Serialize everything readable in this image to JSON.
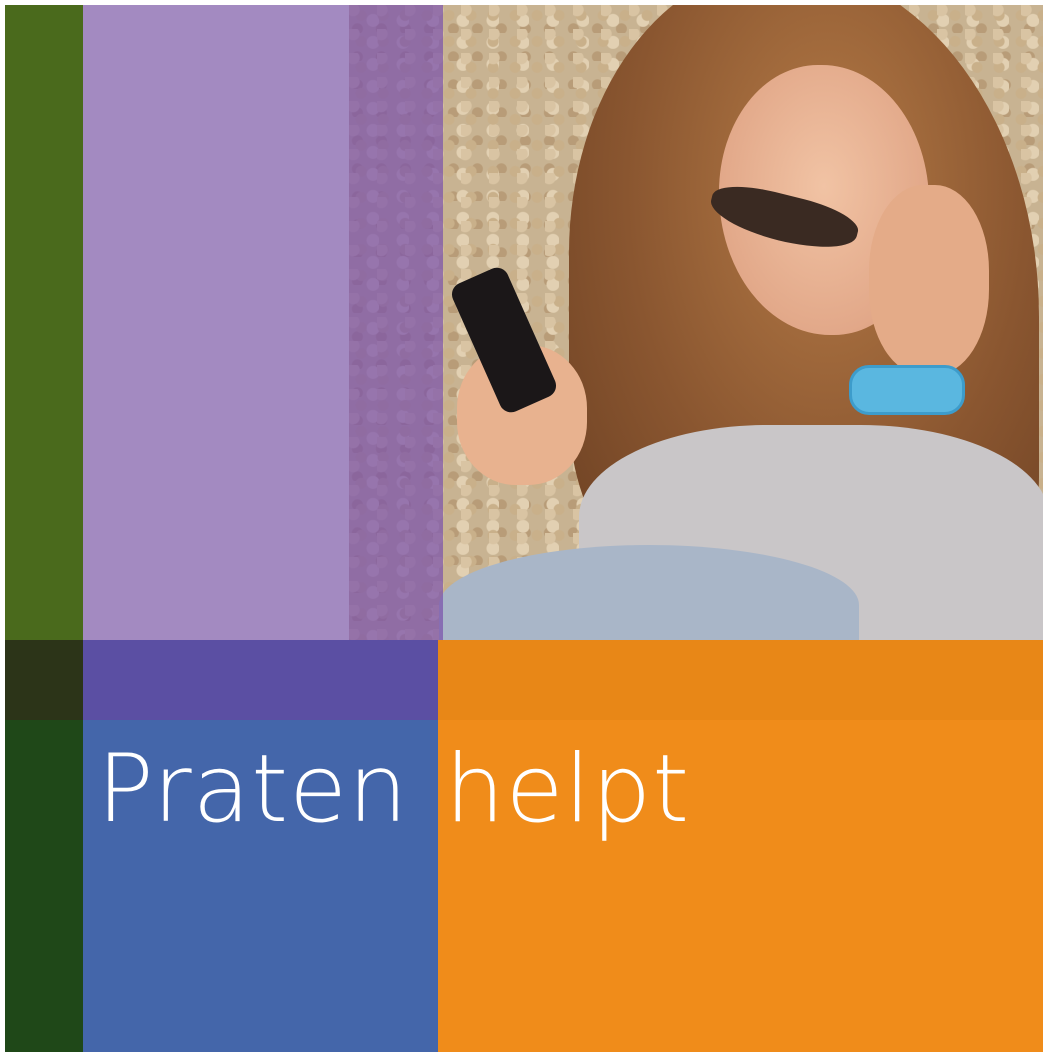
{
  "title": {
    "left_word": "Praten",
    "right_word": "helpt"
  },
  "photo": {
    "icon_name": "girl-with-phone-photo"
  },
  "colors": {
    "green": "#4a6a1c",
    "dark_green": "#1f4818",
    "lilac": "#a38ac1",
    "purple": "#5b4fa3",
    "blue": "#4466aa",
    "orange": "#f08c1a"
  }
}
